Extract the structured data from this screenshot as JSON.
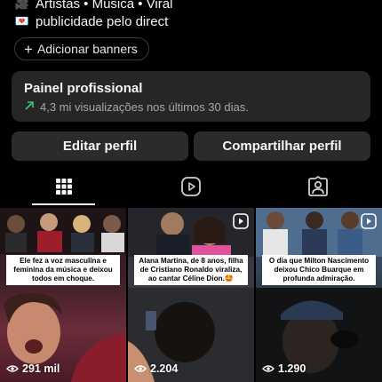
{
  "bio": {
    "lines": [
      {
        "icon": "camera-emoji-icon",
        "text": "Artistas • Música • Viral"
      },
      {
        "icon": "love-letter-emoji-icon",
        "text": "publicidade pelo direct"
      }
    ]
  },
  "add_banners": {
    "label": "Adicionar banners"
  },
  "professional_panel": {
    "title": "Painel profissional",
    "stat": "4,3 mi visualizações nos últimos 30 dias."
  },
  "buttons": {
    "edit_profile": "Editar perfil",
    "share_profile": "Compartilhar perfil"
  },
  "tabs": [
    {
      "icon": "grid-icon",
      "active": true
    },
    {
      "icon": "reels-icon",
      "active": false
    },
    {
      "icon": "tagged-icon",
      "active": false
    }
  ],
  "posts": [
    {
      "caption": "Ele fez a voz masculina e feminina da música e deixou todos em choque.",
      "views": "291 mil",
      "reel": false
    },
    {
      "caption": "Alana Martina, de 8 anos, filha de Cristiano Ronaldo viraliza, ao cantar Céline Dion.🤩",
      "views": "2.204",
      "reel": true
    },
    {
      "caption": "O dia que Milton Nascimento deixou Chico Buarque em profunda admiração.",
      "views": "1.290",
      "reel": true
    }
  ],
  "colors": {
    "background": "#000000",
    "panel": "#262626",
    "button": "#2b2b2b",
    "trend_arrow": "#36c57a"
  }
}
